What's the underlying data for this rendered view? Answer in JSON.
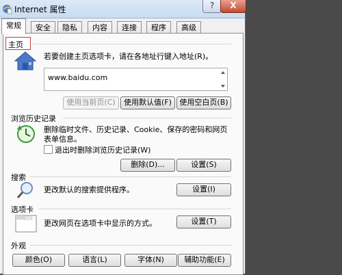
{
  "window": {
    "title": "Internet 属性",
    "help_label": "?",
    "close_label": "X"
  },
  "tabs": [
    {
      "label": "常规"
    },
    {
      "label": "安全"
    },
    {
      "label": "隐私"
    },
    {
      "label": "内容"
    },
    {
      "label": "连接"
    },
    {
      "label": "程序"
    },
    {
      "label": "高级"
    }
  ],
  "home_page": {
    "section_label": "主页",
    "description": "若要创建主页选项卡，请在各地址行键入地址(R)。",
    "address_value": "www.baidu.com",
    "use_current_label": "使用当前页(C)",
    "use_default_label": "使用默认值(F)",
    "use_blank_label": "使用空白页(B)"
  },
  "browsing_history": {
    "section_label": "浏览历史记录",
    "description_line1": "删除临时文件、历史记录、Cookie、保存的密码和网页",
    "description_line2": "表单信息。",
    "delete_on_exit_label": "退出时删除浏览历史记录(W)",
    "delete_label": "删除(D)...",
    "settings_label": "设置(S)"
  },
  "search": {
    "section_label": "搜索",
    "description": "更改默认的搜索提供程序。",
    "settings_label": "设置(I)"
  },
  "tabs_section": {
    "section_label": "选项卡",
    "description": "更改网页在选项卡中显示的方式。",
    "settings_label": "设置(T)"
  },
  "appearance": {
    "section_label": "外观",
    "colors_label": "颜色(O)",
    "languages_label": "语言(L)",
    "fonts_label": "字体(N)",
    "accessibility_label": "辅助功能(E)"
  }
}
